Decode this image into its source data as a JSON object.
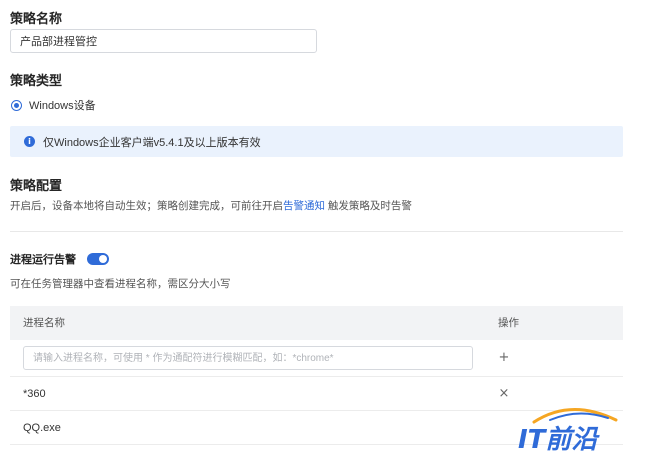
{
  "policy_name": {
    "label": "策略名称",
    "value": "产品部进程管控"
  },
  "policy_type": {
    "label": "策略类型",
    "option": "Windows设备",
    "notice": "仅Windows企业客户端v5.4.1及以上版本有效"
  },
  "policy_config": {
    "label": "策略配置",
    "desc_before": "开启后，设备本地将自动生效；策略创建完成，可前往开启",
    "desc_link": "告警通知",
    "desc_after": " 触发策略及时告警"
  },
  "process_alert": {
    "label": "进程运行告警",
    "enabled": true,
    "hint": "可在任务管理器中查看进程名称，需区分大小写"
  },
  "table": {
    "col_name": "进程名称",
    "col_action": "操作",
    "input_placeholder": "请输入进程名称，可使用 * 作为通配符进行模糊匹配，如：*chrome*",
    "rows": [
      {
        "name": "*360"
      },
      {
        "name": "QQ.exe"
      }
    ]
  },
  "watermark": {
    "text": "IT前沿"
  },
  "colors": {
    "accent": "#2f6bd8",
    "notice_bg": "#eaf2fd",
    "header_bg": "#f2f3f5"
  },
  "icons": {
    "info": "info-icon",
    "add": "plus-icon",
    "remove": "close-icon"
  }
}
